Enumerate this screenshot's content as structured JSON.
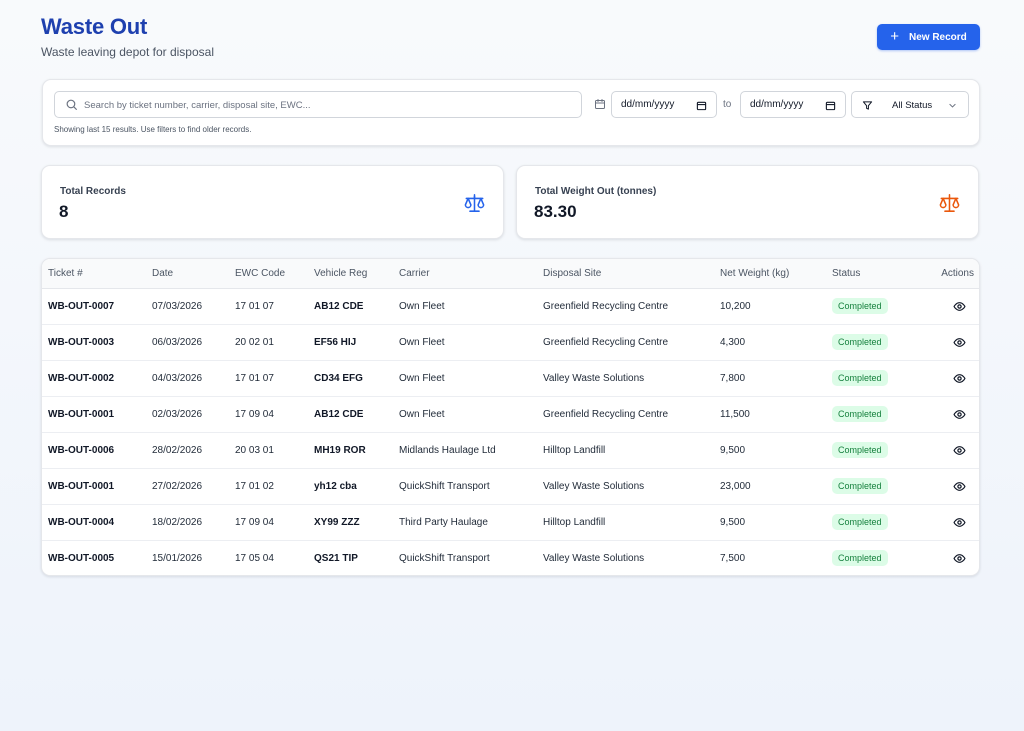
{
  "header": {
    "title": "Waste Out",
    "subtitle": "Waste leaving depot for disposal",
    "new_button_label": "New Record"
  },
  "filters": {
    "search_placeholder": "Search by ticket number, carrier, disposal site, EWC...",
    "search_value": "",
    "hint": "Showing last 15 results. Use filters to find older records.",
    "date_from": "dd/mm/yyyy",
    "date_to": "dd/mm/yyyy",
    "to_label": "to",
    "status_value": "All Status"
  },
  "stats": {
    "total_records_label": "Total Records",
    "total_records_value": "8",
    "total_weight_label": "Total Weight Out (tonnes)",
    "total_weight_value": "83.30"
  },
  "colors": {
    "accent": "#2563eb",
    "title": "#1e40af",
    "records_icon": "#2563eb",
    "weight_icon": "#ea580c",
    "status_bg": "#dcfce7",
    "status_text": "#15803d"
  },
  "icons": {
    "search": "search-icon",
    "calendar": "calendar-icon",
    "filter": "filter-icon",
    "scale": "scale-icon",
    "view": "eye-icon"
  },
  "table": {
    "columns": [
      "Ticket #",
      "Date",
      "EWC Code",
      "Vehicle Reg",
      "Carrier",
      "Disposal Site",
      "Net Weight (kg)",
      "Status",
      "Actions"
    ],
    "rows": [
      {
        "ticket": "WB-OUT-0007",
        "date": "07/03/2026",
        "ewc": "17 01 07",
        "reg": "AB12 CDE",
        "carrier": "Own Fleet",
        "site": "Greenfield Recycling Centre",
        "weight": "10,200",
        "status": "Completed"
      },
      {
        "ticket": "WB-OUT-0003",
        "date": "06/03/2026",
        "ewc": "20 02 01",
        "reg": "EF56 HIJ",
        "carrier": "Own Fleet",
        "site": "Greenfield Recycling Centre",
        "weight": "4,300",
        "status": "Completed"
      },
      {
        "ticket": "WB-OUT-0002",
        "date": "04/03/2026",
        "ewc": "17 01 07",
        "reg": "CD34 EFG",
        "carrier": "Own Fleet",
        "site": "Valley Waste Solutions",
        "weight": "7,800",
        "status": "Completed"
      },
      {
        "ticket": "WB-OUT-0001",
        "date": "02/03/2026",
        "ewc": "17 09 04",
        "reg": "AB12 CDE",
        "carrier": "Own Fleet",
        "site": "Greenfield Recycling Centre",
        "weight": "11,500",
        "status": "Completed"
      },
      {
        "ticket": "WB-OUT-0006",
        "date": "28/02/2026",
        "ewc": "20 03 01",
        "reg": "MH19 ROR",
        "carrier": "Midlands Haulage Ltd",
        "site": "Hilltop Landfill",
        "weight": "9,500",
        "status": "Completed"
      },
      {
        "ticket": "WB-OUT-0001",
        "date": "27/02/2026",
        "ewc": "17 01 02",
        "reg": "yh12 cba",
        "carrier": "QuickShift Transport",
        "site": "Valley Waste Solutions",
        "weight": "23,000",
        "status": "Completed"
      },
      {
        "ticket": "WB-OUT-0004",
        "date": "18/02/2026",
        "ewc": "17 09 04",
        "reg": "XY99 ZZZ",
        "carrier": "Third Party Haulage",
        "site": "Hilltop Landfill",
        "weight": "9,500",
        "status": "Completed"
      },
      {
        "ticket": "WB-OUT-0005",
        "date": "15/01/2026",
        "ewc": "17 05 04",
        "reg": "QS21 TIP",
        "carrier": "QuickShift Transport",
        "site": "Valley Waste Solutions",
        "weight": "7,500",
        "status": "Completed"
      }
    ]
  }
}
